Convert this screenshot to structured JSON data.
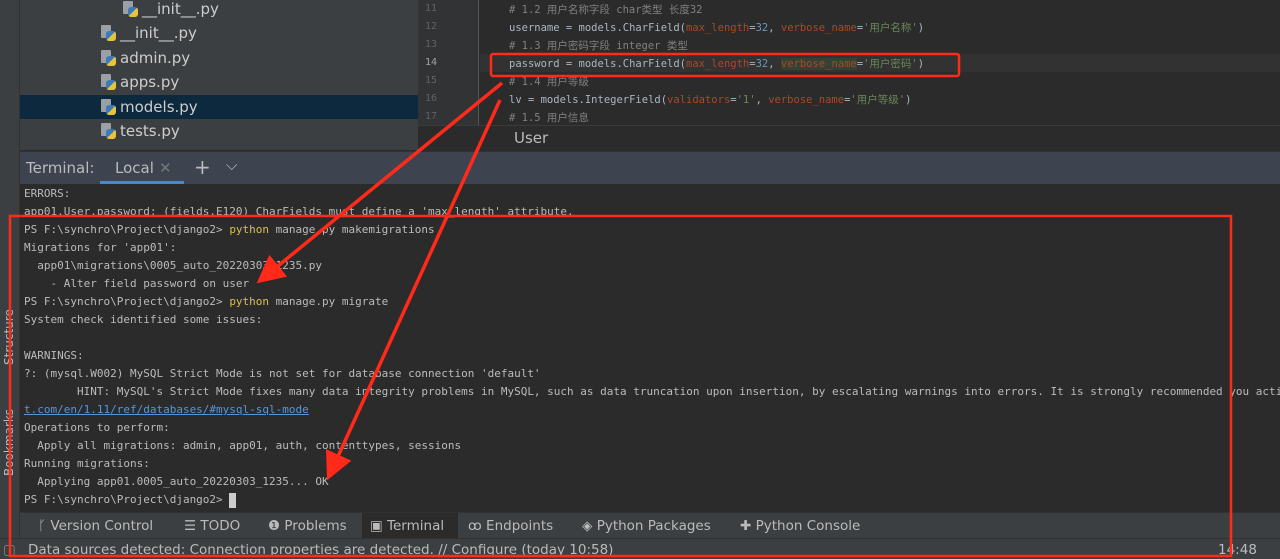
{
  "side_tools": [
    "Structure",
    "Bookmarks"
  ],
  "project_tree": {
    "items": [
      {
        "label": "__init__.py",
        "selected": false
      },
      {
        "label": "__init__.py",
        "selected": false
      },
      {
        "label": "admin.py",
        "selected": false
      },
      {
        "label": "apps.py",
        "selected": false
      },
      {
        "label": "models.py",
        "selected": true
      },
      {
        "label": "tests.py",
        "selected": false
      }
    ]
  },
  "editor": {
    "lines": [
      {
        "n": "11",
        "text": "# 1.2 用户名称字段 char类型 长度32"
      },
      {
        "n": "12",
        "a": "username = models.CharField(",
        "k1": "max_length",
        "b": "=",
        "v1": "32",
        ", ": ", ",
        "k2": "verbose_name",
        "s": "'用户名称'"
      },
      {
        "n": "13",
        "text": "# 1.3 用户密码字段 integer 类型"
      },
      {
        "n": "14",
        "a": "password = models.CharField(",
        "k1": "max_length",
        "v1": "32",
        "k2": "verbose_name",
        "s": "'用户密码'"
      },
      {
        "n": "15",
        "text": "# 1.4 用户等级"
      },
      {
        "n": "16",
        "a": "lv = models.IntegerField(",
        "k1": "validators",
        "v1": "'1'",
        "k2": "verbose_name",
        "s": "'用户等级'"
      },
      {
        "n": "17",
        "text": "# 1.5 用户信息"
      }
    ],
    "breadcrumb": "User"
  },
  "terminal": {
    "title": "Terminal:",
    "tab": "Local",
    "lines": [
      "ERRORS:",
      "app01.User.password: (fields.E120) CharFields must define a 'max_length' attribute.",
      {
        "prompt": "PS F:\\synchro\\Project\\django2> ",
        "cmd": "python",
        "rest": " manage.py makemigrations"
      },
      "Migrations for 'app01':",
      "  app01\\migrations\\0005_auto_20220303_1235.py",
      "    - Alter field password on user",
      {
        "prompt": "PS F:\\synchro\\Project\\django2> ",
        "cmd": "python",
        "rest": " manage.py migrate"
      },
      "System check identified some issues:",
      "",
      "WARNINGS:",
      "?: (mysql.W002) MySQL Strict Mode is not set for database connection 'default'",
      "        HINT: MySQL's Strict Mode fixes many data integrity problems in MySQL, such as data truncation upon insertion, by escalating warnings into errors. It is strongly recommended you activ",
      {
        "link": "t.com/en/1.11/ref/databases/#mysql-sql-mode"
      },
      "Operations to perform:",
      "  Apply all migrations: admin, app01, auth, contenttypes, sessions",
      "Running migrations:",
      "  Applying app01.0005_auto_20220303_1235... OK",
      {
        "prompt": "PS F:\\synchro\\Project\\django2> ",
        "cursor": true
      }
    ]
  },
  "toolbar": [
    {
      "label": "Version Control",
      "icon": "branch-icon"
    },
    {
      "label": "TODO",
      "icon": "list-icon"
    },
    {
      "label": "Problems",
      "icon": "warning-icon"
    },
    {
      "label": "Terminal",
      "icon": "terminal-icon",
      "active": true
    },
    {
      "label": "Endpoints",
      "icon": "endpoints-icon"
    },
    {
      "label": "Python Packages",
      "icon": "packages-icon"
    },
    {
      "label": "Python Console",
      "icon": "python-icon"
    }
  ],
  "status": {
    "message": "Data sources detected: Connection properties are detected. // Configure (today 10:58)",
    "time": "14:48"
  },
  "colors": {
    "annotation": "#ff2a1a",
    "accent": "#4a88c7"
  }
}
